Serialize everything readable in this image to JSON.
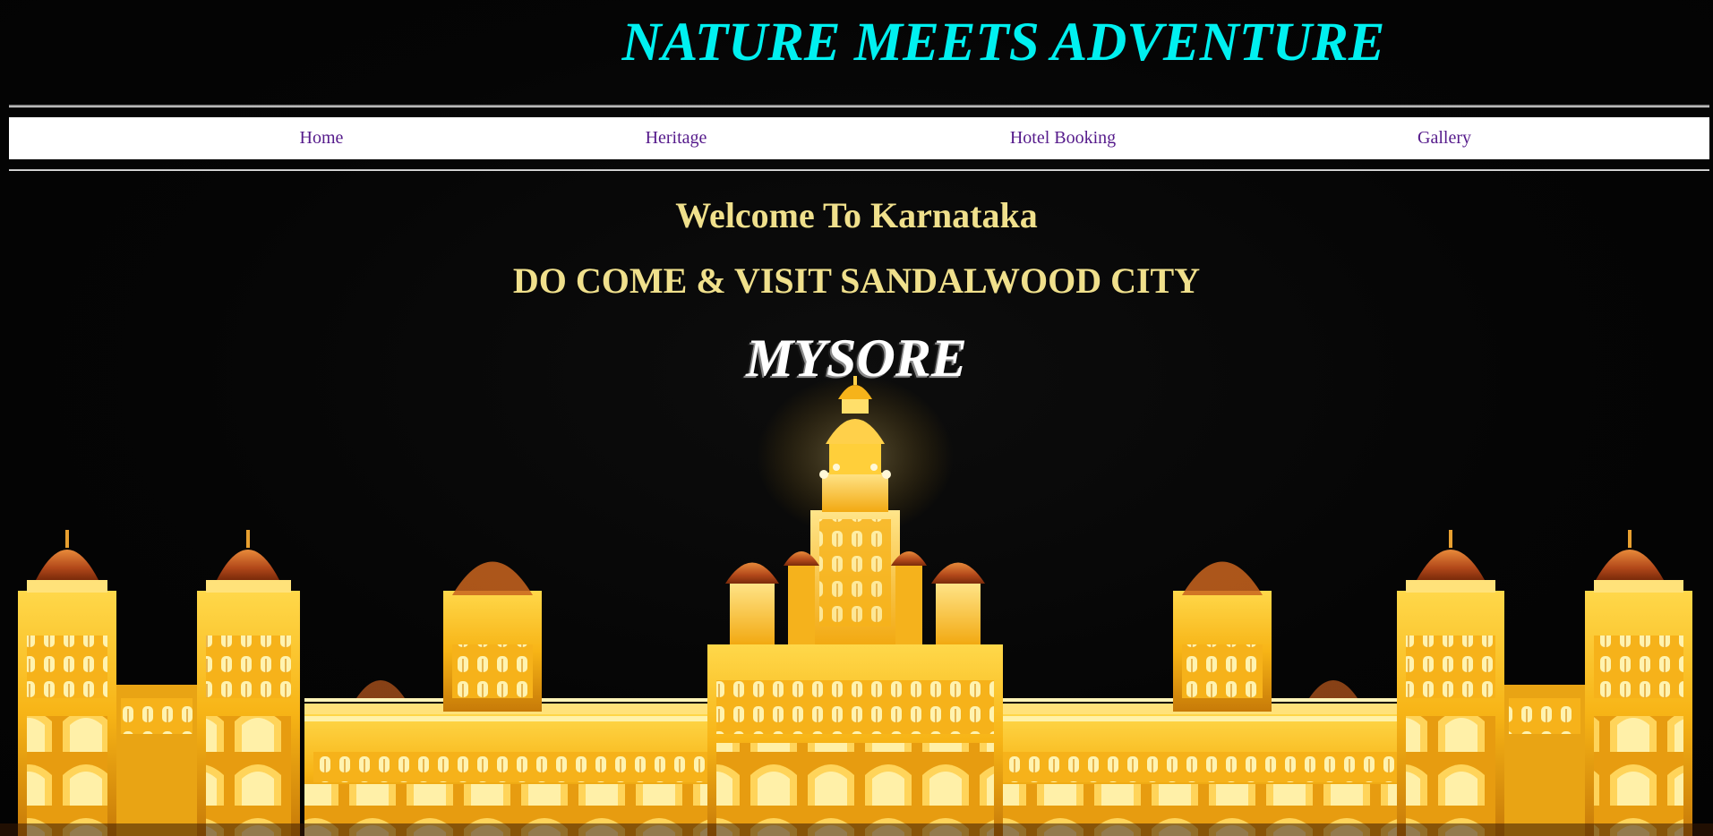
{
  "header": {
    "title": "NATURE MEETS ADVENTURE",
    "title_color": "#00f0f0"
  },
  "nav": {
    "items": [
      {
        "label": "Home"
      },
      {
        "label": "Heritage"
      },
      {
        "label": "Hotel Booking"
      },
      {
        "label": "Gallery"
      }
    ],
    "link_color": "#551a8b"
  },
  "main": {
    "welcome": "Welcome To Karnataka",
    "invite": "DO COME & VISIT SANDALWOOD CITY",
    "city": "MYSORE",
    "heading_color": "#f0e08c",
    "city_color": "#ffffff"
  },
  "hero_image": {
    "subject": "mysore-palace-illuminated-icon",
    "glow_color": "#ffc21a",
    "dome_color": "#c8561a"
  }
}
